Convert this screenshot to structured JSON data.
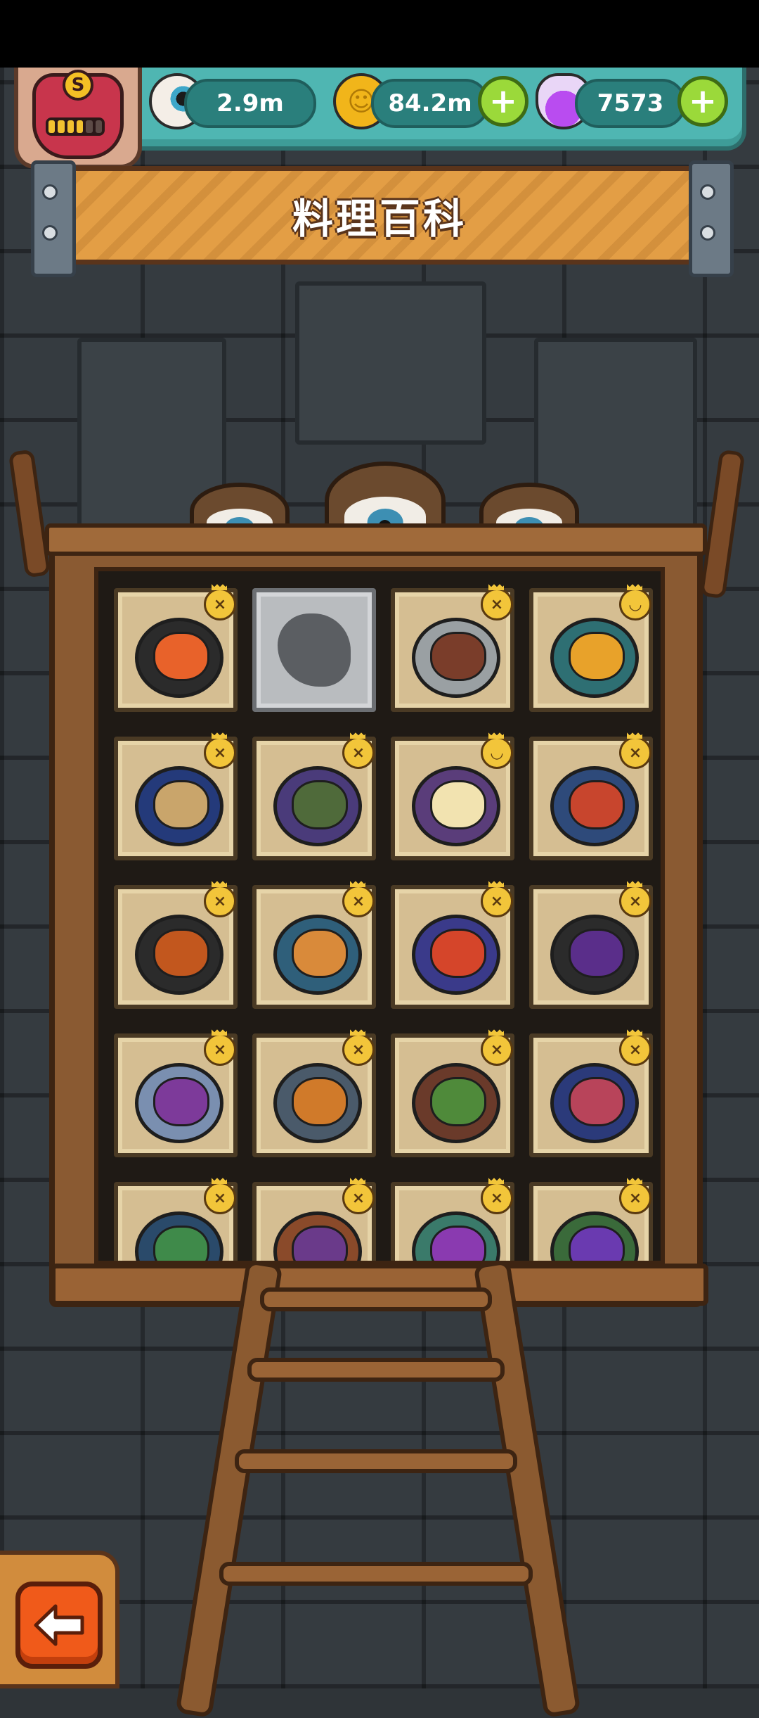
{
  "hud": {
    "eyes_value": "2.9m",
    "coins_value": "84.2m",
    "potions_value": "7573",
    "plus_label": "+",
    "avatar_rank": "S"
  },
  "banner": {
    "title": "料理百科"
  },
  "badges": {
    "dead": "×",
    "happy": "◡"
  },
  "colors": {
    "accent_teal": "#4fb6b2",
    "banner_orange": "#e39e45",
    "plus_green": "#9bd93a",
    "back_orange": "#f05a1a"
  },
  "dishes": [
    {
      "state": "unlocked",
      "badge": "dead",
      "plate": "#2b2b2b",
      "food": "#e8622a"
    },
    {
      "state": "locked",
      "badge": "",
      "plate": "",
      "food": ""
    },
    {
      "state": "unlocked",
      "badge": "dead",
      "plate": "#9aa0a3",
      "food": "#7a3d2a"
    },
    {
      "state": "unlocked",
      "badge": "happy",
      "plate": "#2e6f73",
      "food": "#e8a22a"
    },
    {
      "state": "unlocked",
      "badge": "dead",
      "plate": "#243a7a",
      "food": "#c9a56b"
    },
    {
      "state": "unlocked",
      "badge": "dead",
      "plate": "#4a3b7a",
      "food": "#4f6a3a"
    },
    {
      "state": "unlocked",
      "badge": "happy",
      "plate": "#5a3d7a",
      "food": "#f2e3b0"
    },
    {
      "state": "unlocked",
      "badge": "dead",
      "plate": "#2e4a7a",
      "food": "#c8452d"
    },
    {
      "state": "unlocked",
      "badge": "dead",
      "plate": "#2b2b2b",
      "food": "#c2571e"
    },
    {
      "state": "unlocked",
      "badge": "dead",
      "plate": "#2f5f7a",
      "food": "#d98a3a"
    },
    {
      "state": "unlocked",
      "badge": "dead",
      "plate": "#3a3a8a",
      "food": "#d5452a"
    },
    {
      "state": "unlocked",
      "badge": "dead",
      "plate": "#2b2b2b",
      "food": "#5a2e8a"
    },
    {
      "state": "unlocked",
      "badge": "dead",
      "plate": "#7a8fb0",
      "food": "#7d3a9a"
    },
    {
      "state": "unlocked",
      "badge": "dead",
      "plate": "#4a5a6a",
      "food": "#d07a2a"
    },
    {
      "state": "unlocked",
      "badge": "dead",
      "plate": "#6a3a2a",
      "food": "#4f8a3a"
    },
    {
      "state": "unlocked",
      "badge": "dead",
      "plate": "#2b3a7a",
      "food": "#b8445a"
    },
    {
      "state": "unlocked",
      "badge": "dead",
      "plate": "#2a4a6a",
      "food": "#3f8a4a"
    },
    {
      "state": "unlocked",
      "badge": "dead",
      "plate": "#8a4a2a",
      "food": "#6a3a8a"
    },
    {
      "state": "unlocked",
      "badge": "dead",
      "plate": "#3a7a6a",
      "food": "#8a3ab0"
    },
    {
      "state": "unlocked",
      "badge": "dead",
      "plate": "#3a6a3a",
      "food": "#6a3ab0"
    }
  ]
}
